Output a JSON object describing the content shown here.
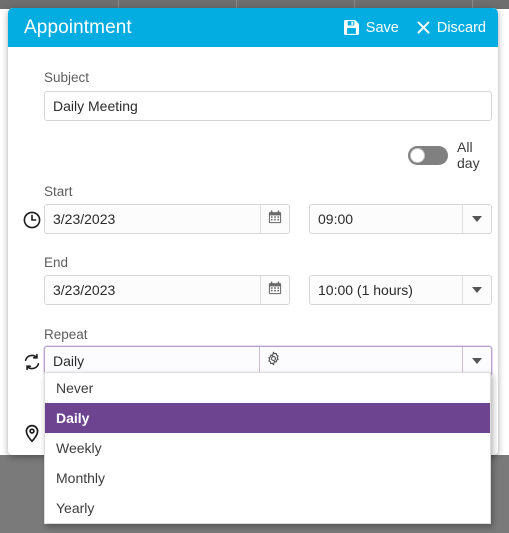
{
  "window": {
    "title": "Appointment",
    "header_color": "#04ade1",
    "actions": [
      {
        "label": "Save",
        "icon": "save-floppy-icon"
      },
      {
        "label": "Discard",
        "icon": "close-x-icon"
      }
    ]
  },
  "form": {
    "subject": {
      "label": "Subject",
      "value": "Daily Meeting",
      "placeholder": "Subject"
    },
    "all_day": {
      "label": "All day",
      "state": "off"
    },
    "start": {
      "label": "Start",
      "icon": "clock-icon",
      "date": "3/23/2023",
      "date_icon": "calendar-icon",
      "time": "09:00"
    },
    "end": {
      "label": "End",
      "icon": "clock-icon",
      "date": "3/23/2023",
      "date_icon": "calendar-icon",
      "time": "10:00 (1 hours)"
    },
    "repeat": {
      "label": "Repeat",
      "icon": "repeat-icon",
      "value": "Daily",
      "settings_icon": "gear-icon",
      "dropdown_icon": "chevron-down-icon",
      "focus_color": "#b7a0cc"
    },
    "location": {
      "icon": "location-pin-icon"
    }
  },
  "repeat_dropdown": {
    "open": true,
    "selected": "Daily",
    "highlight_color": "#6d4490",
    "options": [
      {
        "label": "Never"
      },
      {
        "label": "Daily"
      },
      {
        "label": "Weekly"
      },
      {
        "label": "Monthly"
      },
      {
        "label": "Yearly"
      }
    ]
  }
}
